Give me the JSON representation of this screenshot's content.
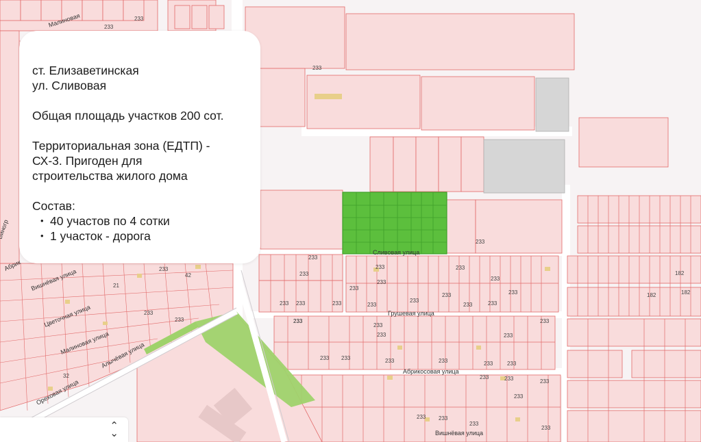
{
  "info": {
    "line1": "ст. Елизаветинская",
    "line2": "ул. Сливовая",
    "area": "Общая площадь участков 200 сот.",
    "zone_1": "Территориальная зона (ЕДТП) -",
    "zone_2": "СХ-3. Пригоден для",
    "zone_3": "строительства жилого дома",
    "composition_title": "Состав:",
    "items": [
      "40 участов по 4 сотки",
      "1 участок - дорога"
    ]
  },
  "map": {
    "streets": {
      "slivovaya": "Сливовая улица",
      "grushevaya": "Грушевая улица",
      "abrikosovaya": "Абрикосовая улица",
      "vishnevaya_bottom": "Вишнёвая улица",
      "vishnevaya_left": "Вишнёвая улица",
      "tsvetochnaya": "Цветочная улица",
      "malinovaya": "Малиновая улица",
      "alycha": "Алычёвая улица",
      "orekhovaya": "Ореховая улица",
      "malinovaya_top": "Малиновая",
      "vinogr": "Виногр",
      "abr": "Абрик"
    },
    "labels": {
      "n233": "233",
      "n182": "182",
      "n21": "21",
      "n32": "32",
      "n42": "42"
    },
    "colors": {
      "parcel_fill": "#f9dcdc",
      "parcel_line": "#e26a6a",
      "highlight": "#5cbf3d",
      "park": "#9fd26b",
      "gray_parcel": "#d6d6d6",
      "road": "#eae7ea"
    }
  },
  "select": {
    "chevron": "⌃⌄"
  }
}
